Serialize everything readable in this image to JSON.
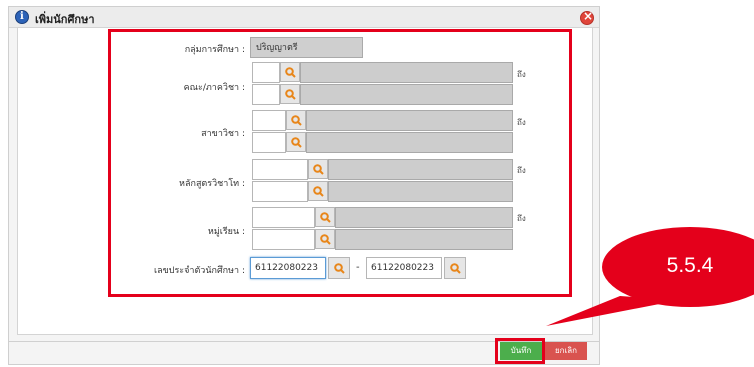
{
  "dialog": {
    "title": "เพิ่มนักศึกษา",
    "icons": {
      "info": "info-icon",
      "close": "close-icon"
    }
  },
  "form": {
    "level_label": "กลุ่มการศึกษา :",
    "level_value": "ปริญญาตรี",
    "faculty_label": "คณะ/ภาควิชา :",
    "major_label": "สาขาวิชา :",
    "curriculum_label": "หลักสูตรวิชาโท :",
    "group_label": "หมู่เรียน :",
    "to_text": "ถึง",
    "student_id_label": "เลขประจำตัวนักศึกษา :",
    "student_id_from": "61122080223",
    "student_id_to": "61122080223",
    "range_separator": "-"
  },
  "footer": {
    "save_label": "บันทึก",
    "cancel_label": "ยกเลิก"
  },
  "annotation": {
    "label": "5.5.4",
    "color": "#e4001b"
  },
  "colors": {
    "save": "#4cae4c",
    "cancel": "#d9534f",
    "search_icon": "#e8861a",
    "highlight": "#e4001b"
  }
}
